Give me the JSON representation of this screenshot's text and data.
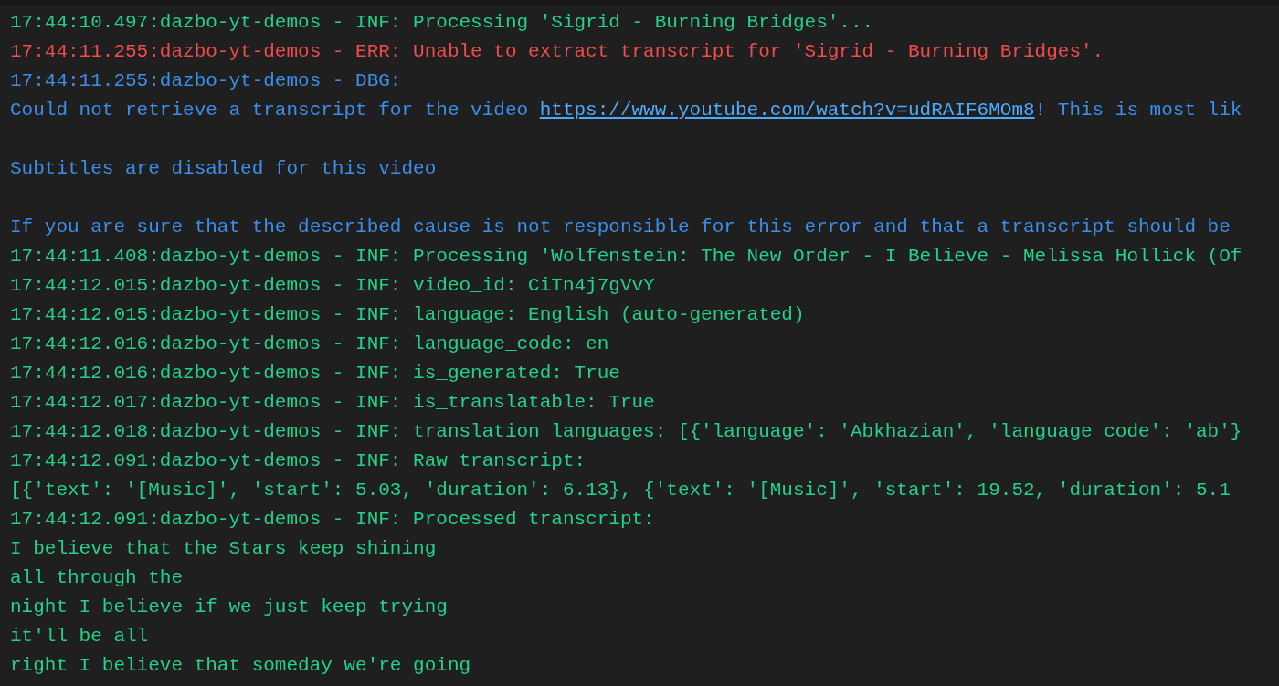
{
  "terminal": {
    "lines": [
      {
        "kind": "info",
        "text": "17:44:10.497:dazbo-yt-demos - INF: Processing 'Sigrid - Burning Bridges'..."
      },
      {
        "kind": "error",
        "text": "17:44:11.255:dazbo-yt-demos - ERR: Unable to extract transcript for 'Sigrid - Burning Bridges'."
      },
      {
        "kind": "debug",
        "text": "17:44:11.255:dazbo-yt-demos - DBG:"
      },
      {
        "kind": "debug",
        "text": "Could not retrieve a transcript for the video",
        "link": "https://www.youtube.com/watch?v=udRAIF6MOm8",
        "text_after": "! This is most lik"
      },
      {
        "kind": "blank"
      },
      {
        "kind": "debug",
        "text": "Subtitles are disabled for this video"
      },
      {
        "kind": "blank"
      },
      {
        "kind": "debug",
        "text": "If you are sure that the described cause is not responsible for this error and that a transcript should be"
      },
      {
        "kind": "info",
        "text": "17:44:11.408:dazbo-yt-demos - INF: Processing 'Wolfenstein: The New Order - I Believe - Melissa Hollick (Of"
      },
      {
        "kind": "info",
        "text": "17:44:12.015:dazbo-yt-demos - INF: video_id: CiTn4j7gVvY"
      },
      {
        "kind": "info",
        "text": "17:44:12.015:dazbo-yt-demos - INF: language: English (auto-generated)"
      },
      {
        "kind": "info",
        "text": "17:44:12.016:dazbo-yt-demos - INF: language_code: en"
      },
      {
        "kind": "info",
        "text": "17:44:12.016:dazbo-yt-demos - INF: is_generated: True"
      },
      {
        "kind": "info",
        "text": "17:44:12.017:dazbo-yt-demos - INF: is_translatable: True"
      },
      {
        "kind": "info",
        "text": "17:44:12.018:dazbo-yt-demos - INF: translation_languages: [{'language': 'Abkhazian', 'language_code': 'ab'}"
      },
      {
        "kind": "info",
        "text": "17:44:12.091:dazbo-yt-demos - INF: Raw transcript:"
      },
      {
        "kind": "info",
        "text": "[{'text': '[Music]', 'start': 5.03, 'duration': 6.13}, {'text': '[Music]', 'start': 19.52, 'duration': 5.1"
      },
      {
        "kind": "info",
        "text": "17:44:12.091:dazbo-yt-demos - INF: Processed transcript:"
      },
      {
        "kind": "info",
        "text": "I believe that the Stars keep shining"
      },
      {
        "kind": "info",
        "text": "all through the"
      },
      {
        "kind": "info",
        "text": "night I believe if we just keep trying"
      },
      {
        "kind": "info",
        "text": "it'll be all"
      },
      {
        "kind": "info",
        "text": "right I believe that someday we're going"
      }
    ]
  }
}
